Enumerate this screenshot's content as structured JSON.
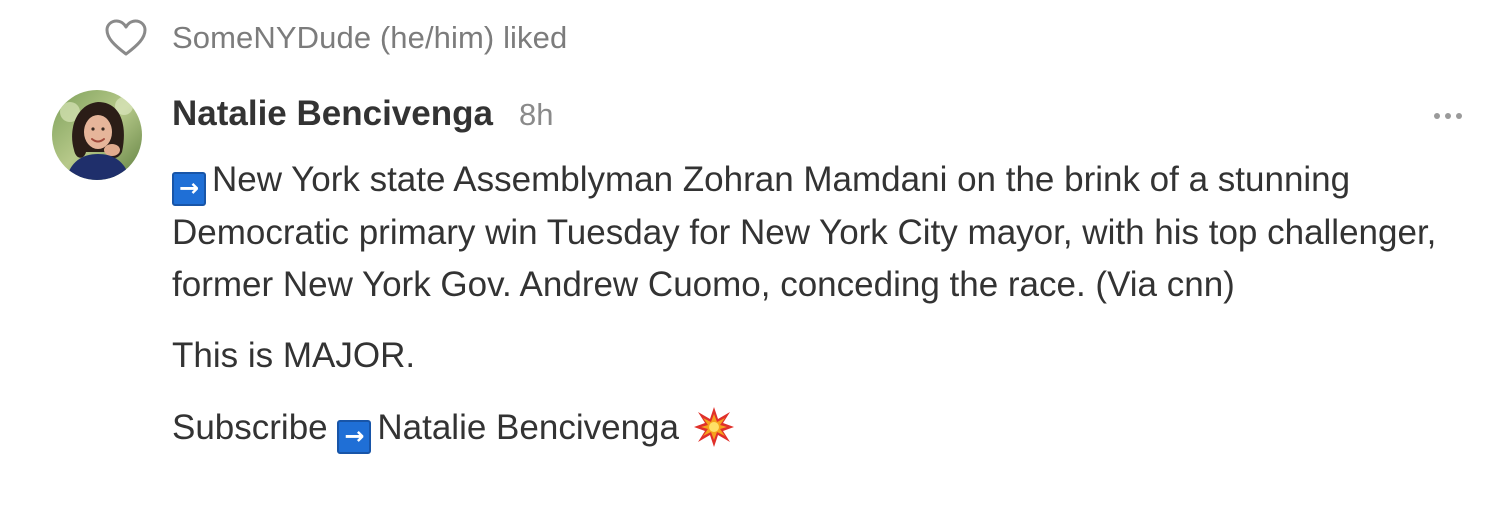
{
  "activity": {
    "liked_text": "SomeNYDude (he/him) liked",
    "icon": "heart-outline-icon"
  },
  "post": {
    "author": "Natalie Bencivenga",
    "time": "8h",
    "avatar_icon": "avatar",
    "more_icon": "more-horizontal-icon",
    "arrow_glyph": "→",
    "paragraph1": "New York state Assemblyman Zohran Mamdani on the brink of a stunning Democratic primary win Tuesday for New York City mayor, with his top challenger, former New York Gov. Andrew Cuomo, conceding the race. (Via cnn)",
    "paragraph2": "This is MAJOR.",
    "subscribe_prefix": "Subscribe",
    "subscribe_name": "Natalie Bencivenga",
    "emoji": "collision-icon"
  },
  "colors": {
    "text": "#333333",
    "muted": "#7c7c7c",
    "arrow_box": "#1f6fd6"
  }
}
